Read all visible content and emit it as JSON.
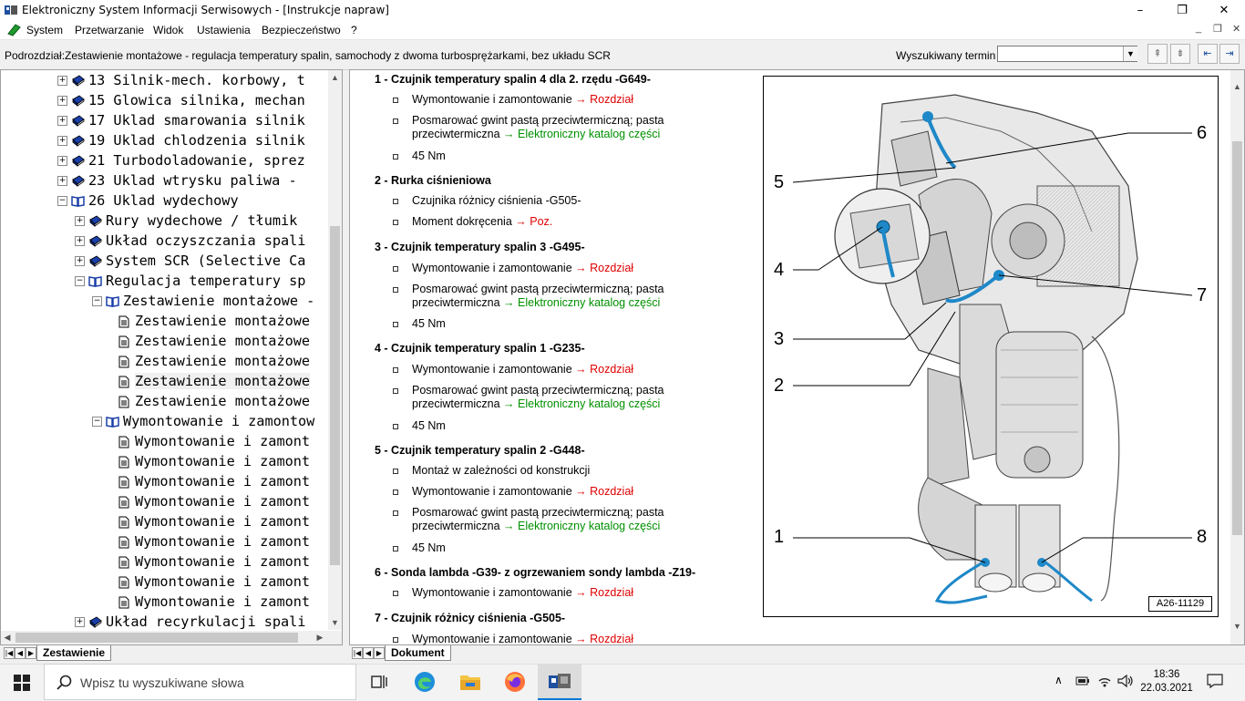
{
  "window": {
    "title": "Elektroniczny System Informacji Serwisowych - [Instrukcje napraw]",
    "controls": {
      "minimize": "–",
      "maximize": "❐",
      "close": "✕"
    }
  },
  "menu": {
    "items": [
      "System",
      "Przetwarzanie",
      "Widok",
      "Ustawienia",
      "Bezpieczeństwo",
      "?"
    ],
    "mdi": {
      "minimize": "_",
      "restore": "❐",
      "close": "✕"
    }
  },
  "toolbar": {
    "breadcrumb": "Podrozdział:Zestawienie montażowe - regulacja temperatury spalin, samochody z dwoma turbosprężarkami, bez układu SCR",
    "search_label": "Wyszukiwany termin",
    "search_value": ""
  },
  "tree": {
    "items": [
      {
        "label": "13 Silnik-mech. korbowy, t",
        "type": "book",
        "exp": "+"
      },
      {
        "label": "15 Glowica silnika, mechan",
        "type": "book",
        "exp": "+"
      },
      {
        "label": "17 Uklad smarowania silnik",
        "type": "book",
        "exp": "+"
      },
      {
        "label": "19 Uklad chlodzenia silnik",
        "type": "book",
        "exp": "+"
      },
      {
        "label": "21 Turbodoladowanie, sprez",
        "type": "book",
        "exp": "+"
      },
      {
        "label": "23 Uklad wtrysku paliwa -",
        "type": "book",
        "exp": "+"
      },
      {
        "label": "26 Uklad wydechowy",
        "type": "openbook",
        "exp": "−"
      },
      {
        "label": "Rury wydechowe / tłumik",
        "type": "book",
        "exp": "+"
      },
      {
        "label": "Układ oczyszczania spali",
        "type": "book",
        "exp": "+"
      },
      {
        "label": "System SCR (Selective Ca",
        "type": "book",
        "exp": "+"
      },
      {
        "label": "Regulacja temperatury sp",
        "type": "openbook",
        "exp": "−"
      },
      {
        "label": "Zestawienie montażowe -",
        "type": "openbook",
        "exp": "−"
      },
      {
        "label": "Zestawienie montażowe",
        "type": "doc"
      },
      {
        "label": "Zestawienie montażowe",
        "type": "doc"
      },
      {
        "label": "Zestawienie montażowe",
        "type": "doc"
      },
      {
        "label": "Zestawienie montażowe",
        "type": "doc",
        "selected": true
      },
      {
        "label": "Zestawienie montażowe",
        "type": "doc"
      },
      {
        "label": "Wymontowanie i zamontow",
        "type": "openbook",
        "exp": "−"
      },
      {
        "label": "Wymontowanie i zamont",
        "type": "doc"
      },
      {
        "label": "Wymontowanie i zamont",
        "type": "doc"
      },
      {
        "label": "Wymontowanie i zamont",
        "type": "doc"
      },
      {
        "label": "Wymontowanie i zamont",
        "type": "doc"
      },
      {
        "label": "Wymontowanie i zamont",
        "type": "doc"
      },
      {
        "label": "Wymontowanie i zamont",
        "type": "doc"
      },
      {
        "label": "Wymontowanie i zamont",
        "type": "doc"
      },
      {
        "label": "Wymontowanie i zamont",
        "type": "doc"
      },
      {
        "label": "Wymontowanie i zamont",
        "type": "doc"
      },
      {
        "label": "Układ recyrkulacji spali",
        "type": "book",
        "exp": "+"
      }
    ],
    "tab": "Zestawienie"
  },
  "document": {
    "tab": "Dokument",
    "sections": [
      {
        "heading": "1 - Czujnik temperatury spalin 4 dla 2. rzędu -G649-",
        "items": [
          {
            "text": "Wymontowanie i zamontowanie",
            "link": "→ Rozdział",
            "link_color": "red"
          },
          {
            "text": "Posmarować gwint pastą przeciwtermiczną; pasta",
            "text2": "przeciwtermiczna",
            "link": "→ Elektroniczny katalog części",
            "link_color": "green"
          },
          {
            "text": "45 Nm"
          }
        ]
      },
      {
        "heading": "2 - Rurka ciśnieniowa",
        "items": [
          {
            "text": "Czujnika różnicy ciśnienia -G505-"
          },
          {
            "text": "Moment dokręcenia",
            "link": "→ Poz.",
            "link_color": "red"
          }
        ]
      },
      {
        "heading": "3 - Czujnik temperatury spalin 3 -G495-",
        "items": [
          {
            "text": "Wymontowanie i zamontowanie",
            "link": "→ Rozdział",
            "link_color": "red"
          },
          {
            "text": "Posmarować gwint pastą przeciwtermiczną; pasta",
            "text2": "przeciwtermiczna",
            "link": "→ Elektroniczny katalog części",
            "link_color": "green"
          },
          {
            "text": "45 Nm"
          }
        ]
      },
      {
        "heading": "4 - Czujnik temperatury spalin 1 -G235-",
        "items": [
          {
            "text": "Wymontowanie i zamontowanie",
            "link": "→ Rozdział",
            "link_color": "red"
          },
          {
            "text": "Posmarować gwint pastą przeciwtermiczną; pasta",
            "text2": "przeciwtermiczna",
            "link": "→ Elektroniczny katalog części",
            "link_color": "green"
          },
          {
            "text": "45 Nm"
          }
        ]
      },
      {
        "heading": "5 - Czujnik temperatury spalin 2 -G448-",
        "items": [
          {
            "text": "Montaż w zależności od konstrukcji"
          },
          {
            "text": "Wymontowanie i zamontowanie",
            "link": "→ Rozdział",
            "link_color": "red"
          },
          {
            "text": "Posmarować gwint pastą przeciwtermiczną; pasta",
            "text2": "przeciwtermiczna",
            "link": "→ Elektroniczny katalog części",
            "link_color": "green"
          },
          {
            "text": "45 Nm"
          }
        ]
      },
      {
        "heading": "6 - Sonda lambda -G39- z ogrzewaniem sondy lambda -Z19-",
        "items": [
          {
            "text": "Wymontowanie i zamontowanie",
            "link": "→ Rozdział",
            "link_color": "red"
          }
        ]
      },
      {
        "heading": "7 - Czujnik różnicy ciśnienia -G505-",
        "items": [
          {
            "text": "Wymontowanie i zamontowanie",
            "link": "→ Rozdział",
            "link_color": "red"
          }
        ]
      }
    ]
  },
  "figure": {
    "id": "A26-11129",
    "callouts": [
      "6",
      "5",
      "4",
      "7",
      "3",
      "2",
      "1",
      "8"
    ]
  },
  "taskbar": {
    "search_placeholder": "Wpisz tu wyszukiwane słowa",
    "time": "18:36",
    "date": "22.03.2021"
  },
  "colors": {
    "link_red": "#e00000",
    "link_green": "#009000",
    "book_blue": "#1a3fa8",
    "sensor_blue": "#1e88c8"
  }
}
